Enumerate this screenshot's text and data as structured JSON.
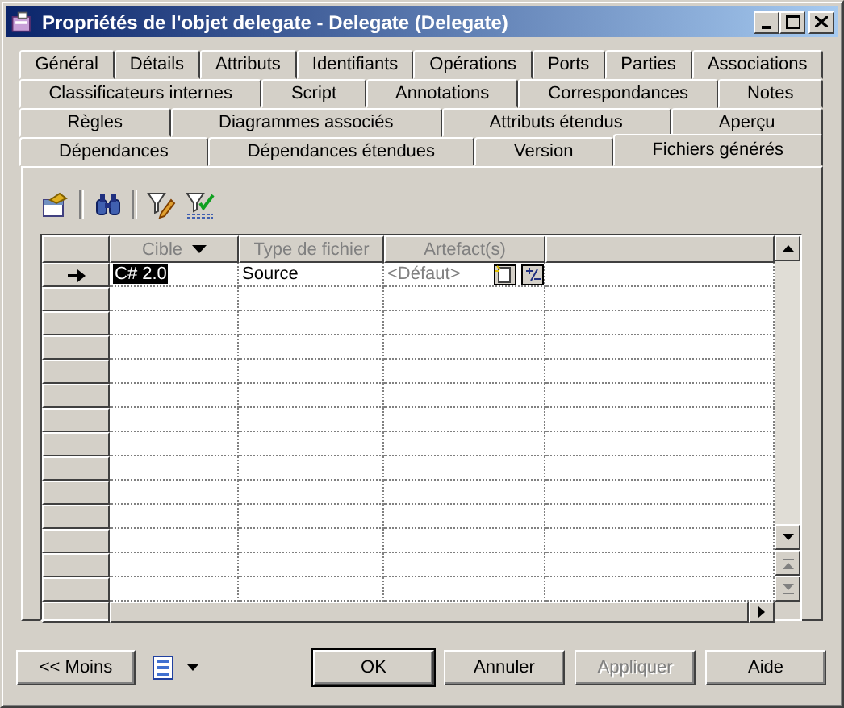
{
  "window": {
    "title": "Propriétés de l'objet delegate - Delegate (Delegate)"
  },
  "tab_rows": [
    [
      {
        "label": "Général",
        "selected": false
      },
      {
        "label": "Détails",
        "selected": false
      },
      {
        "label": "Attributs",
        "selected": false
      },
      {
        "label": "Identifiants",
        "selected": false
      },
      {
        "label": "Opérations",
        "selected": false
      },
      {
        "label": "Ports",
        "selected": false
      },
      {
        "label": "Parties",
        "selected": false
      },
      {
        "label": "Associations",
        "selected": false
      }
    ],
    [
      {
        "label": "Classificateurs internes",
        "selected": false
      },
      {
        "label": "Script",
        "selected": false
      },
      {
        "label": "Annotations",
        "selected": false
      },
      {
        "label": "Correspondances",
        "selected": false
      },
      {
        "label": "Notes",
        "selected": false
      }
    ],
    [
      {
        "label": "Règles",
        "selected": false
      },
      {
        "label": "Diagrammes associés",
        "selected": false
      },
      {
        "label": "Attributs étendus",
        "selected": false
      },
      {
        "label": "Aperçu",
        "selected": false
      }
    ],
    [
      {
        "label": "Dépendances",
        "selected": false
      },
      {
        "label": "Dépendances étendues",
        "selected": false
      },
      {
        "label": "Version",
        "selected": false
      },
      {
        "label": "Fichiers générés",
        "selected": true
      }
    ]
  ],
  "table": {
    "columns": [
      {
        "label": "Cible",
        "dropdown": true
      },
      {
        "label": "Type de fichier",
        "dropdown": false
      },
      {
        "label": "Artefact(s)",
        "dropdown": false
      }
    ],
    "rows": [
      {
        "current": true,
        "target": {
          "text": "C# 2.0",
          "selected": true
        },
        "file_type": "Source",
        "artifacts": {
          "text": "<Défaut>",
          "inherited": true
        }
      }
    ]
  },
  "footer": {
    "less_button": "<< Moins",
    "buttons": [
      {
        "label": "OK",
        "default": true,
        "disabled": false
      },
      {
        "label": "Annuler",
        "default": false,
        "disabled": false
      },
      {
        "label": "Appliquer",
        "default": false,
        "disabled": true
      },
      {
        "label": "Aide",
        "default": false,
        "disabled": false
      }
    ]
  }
}
